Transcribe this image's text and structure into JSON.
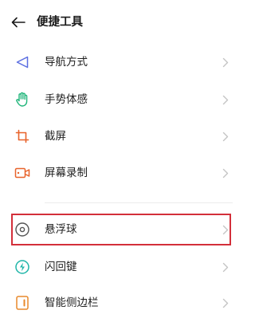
{
  "header": {
    "title": "便捷工具",
    "back_icon": "back-arrow-icon"
  },
  "menu": {
    "items": [
      {
        "label": "导航方式",
        "icon": "navigation-triangle-icon",
        "icon_color": "#5b6ee1"
      },
      {
        "label": "手势体感",
        "icon": "hand-gesture-icon",
        "icon_color": "#1fb57a"
      },
      {
        "label": "截屏",
        "icon": "crop-screenshot-icon",
        "icon_color": "#e8632b"
      },
      {
        "label": "屏幕录制",
        "icon": "screen-record-icon",
        "icon_color": "#e8632b"
      },
      {
        "label": "悬浮球",
        "icon": "floating-ball-icon",
        "icon_color": "#555555"
      },
      {
        "label": "闪回键",
        "icon": "flashback-lightning-icon",
        "icon_color": "#1fb5a8"
      },
      {
        "label": "智能侧边栏",
        "icon": "smart-sidebar-icon",
        "icon_color": "#e8892b"
      }
    ]
  },
  "highlight": {
    "target": "悬浮球",
    "color": "#d32f3a"
  }
}
